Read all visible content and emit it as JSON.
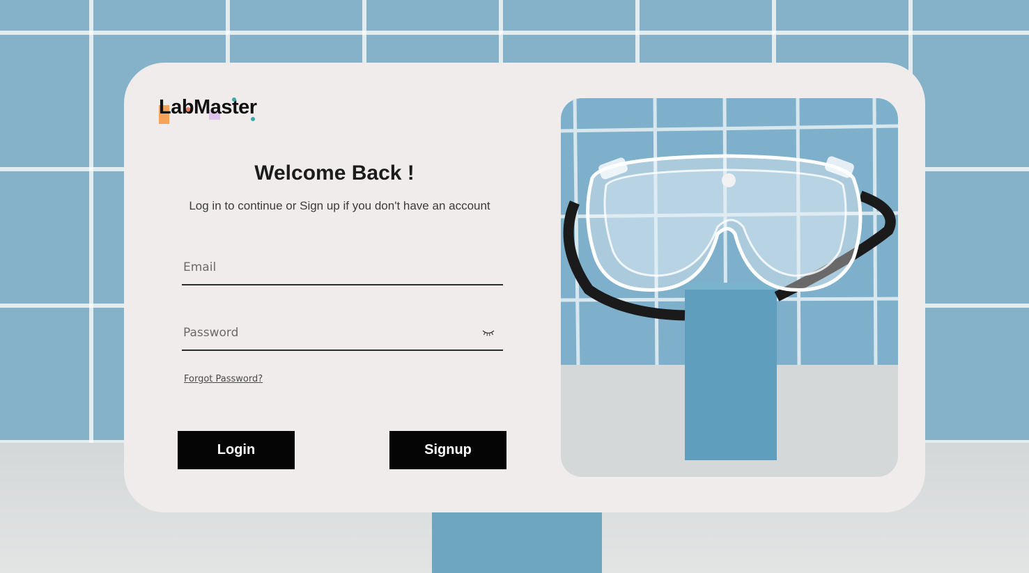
{
  "logo": {
    "text": "LabMaster"
  },
  "login_form": {
    "title": "Welcome Back !",
    "subtitle": "Log in to continue or Sign up if you don't have an account",
    "email": {
      "placeholder": "Email",
      "value": ""
    },
    "password": {
      "placeholder": "Password",
      "value": ""
    },
    "toggle_icon": "eye-closed-icon",
    "forgot_link": "Forgot Password?",
    "login_button": "Login",
    "signup_button": "Signup"
  },
  "colors": {
    "card_bg": "#f0ecec",
    "button_bg": "#050505",
    "button_text": "#ffffff",
    "tile_blue": "#86b2c9",
    "logo_orange": "#f5a35a",
    "logo_lilac": "#dcc3ec",
    "logo_teal": "#38a7a5"
  },
  "hero_image": {
    "subject": "safety-goggles-on-blue-pedestal"
  }
}
